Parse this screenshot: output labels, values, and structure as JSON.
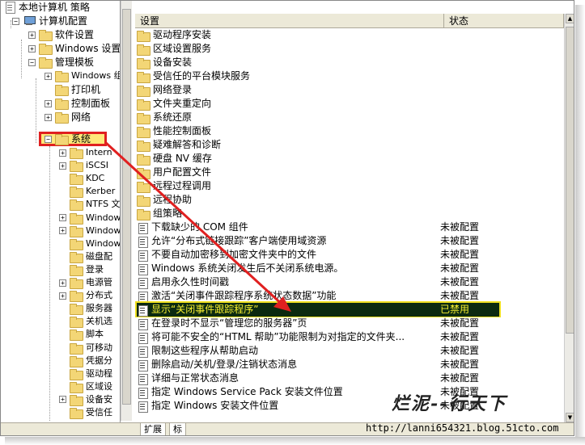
{
  "tree": {
    "root_label": "本地计算机 策略",
    "computer_config": "计算机配置",
    "software_settings": "软件设置",
    "windows_settings": "Windows 设置",
    "admin_templates": "管理模板",
    "windows_components": "Windows 组",
    "printers": "打印机",
    "control_panel": "控制面板",
    "network": "网络",
    "system": "系统",
    "system_children": [
      "Intern",
      "iSCSI",
      "KDC",
      "Kerber",
      "NTFS 文",
      "Window",
      "Window",
      "Window",
      "磁盘配",
      "登录",
      "电源管",
      "分布式",
      "服务器",
      "关机选",
      "脚本",
      "可移动",
      "凭据分",
      "驱动程",
      "区域设",
      "设备安",
      "受信任"
    ]
  },
  "list": {
    "header_setting": "设置",
    "header_state": "状态",
    "folders": [
      "驱动程序安装",
      "区域设置服务",
      "设备安装",
      "受信任的平台模块服务",
      "网络登录",
      "文件夹重定向",
      "系统还原",
      "性能控制面板",
      "疑难解答和诊断",
      "硬盘 NV 缓存",
      "用户配置文件",
      "远程过程调用",
      "远程协助",
      "组策略"
    ],
    "settings": [
      {
        "name": "下载缺少的 COM 组件",
        "state": "未被配置"
      },
      {
        "name": "允许“分布式链接跟踪”客户端使用域资源",
        "state": "未被配置"
      },
      {
        "name": "不要自动加密移到加密文件夹中的文件",
        "state": "未被配置"
      },
      {
        "name": "Windows 系统关闭发生后不关闭系统电源。",
        "state": "未被配置"
      },
      {
        "name": "启用永久性时间戳",
        "state": "未被配置"
      },
      {
        "name": "激活“关闭事件跟踪程序系统状态数据”功能",
        "state": "未被配置"
      },
      {
        "name": "显示“关闭事件跟踪程序”",
        "state": "已禁用"
      },
      {
        "name": "在登录时不显示“管理您的服务器”页",
        "state": "未被配置"
      },
      {
        "name": "将可能不安全的“HTML 帮助”功能限制为对指定的文件夹...",
        "state": "未被配置"
      },
      {
        "name": "限制这些程序从帮助启动",
        "state": "未被配置"
      },
      {
        "name": "删除启动/关机/登录/注销状态消息",
        "state": "未被配置"
      },
      {
        "name": "详细与正常状态消息",
        "state": "未被配置"
      },
      {
        "name": "指定 Windows Service Pack 安装文件位置",
        "state": "未被配置"
      },
      {
        "name": "指定 Windows 安装文件位置",
        "state": "未被配置"
      }
    ]
  },
  "tabs": {
    "extended": "扩展",
    "standard": "标"
  },
  "watermark": "烂泥--行天下",
  "url": "http://lanni654321.blog.51cto.com",
  "colors": {
    "highlight_bg": "#0b2a10",
    "highlight_text": "#f7ef2f",
    "arrow": "#e02020"
  }
}
